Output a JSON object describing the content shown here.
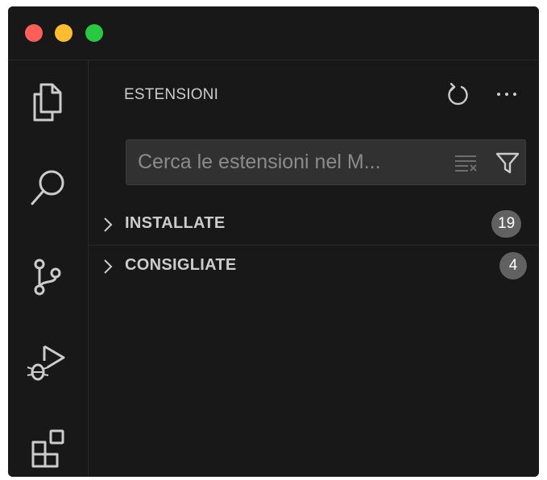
{
  "window": {
    "traffic_lights": [
      {
        "name": "close",
        "color": "#ff5f57"
      },
      {
        "name": "minimize",
        "color": "#febc2e"
      },
      {
        "name": "maximize",
        "color": "#28c840"
      }
    ]
  },
  "activity_bar": {
    "items": [
      {
        "id": "explorer",
        "icon": "files-icon"
      },
      {
        "id": "search",
        "icon": "search-icon"
      },
      {
        "id": "source-control",
        "icon": "source-control-icon"
      },
      {
        "id": "run-debug",
        "icon": "run-debug-icon"
      },
      {
        "id": "extensions",
        "icon": "extensions-icon"
      }
    ]
  },
  "sidebar": {
    "title": "ESTENSIONI",
    "refresh_icon": "refresh-icon",
    "more_icon": "more-actions-icon",
    "search": {
      "placeholder": "Cerca le estensioni nel M...",
      "value": "",
      "clear_icon": "clear-filter-icon",
      "filter_icon": "filter-icon"
    },
    "sections": [
      {
        "label": "INSTALLATE",
        "count": "19",
        "icon": "chevron-right-icon"
      },
      {
        "label": "CONSIGLIATE",
        "count": "4",
        "icon": "chevron-right-icon"
      }
    ]
  },
  "colors": {
    "background": "#181818",
    "foreground": "#cccccc",
    "icon": "#cccccc",
    "badge": "#616161",
    "input_background": "#313131"
  }
}
